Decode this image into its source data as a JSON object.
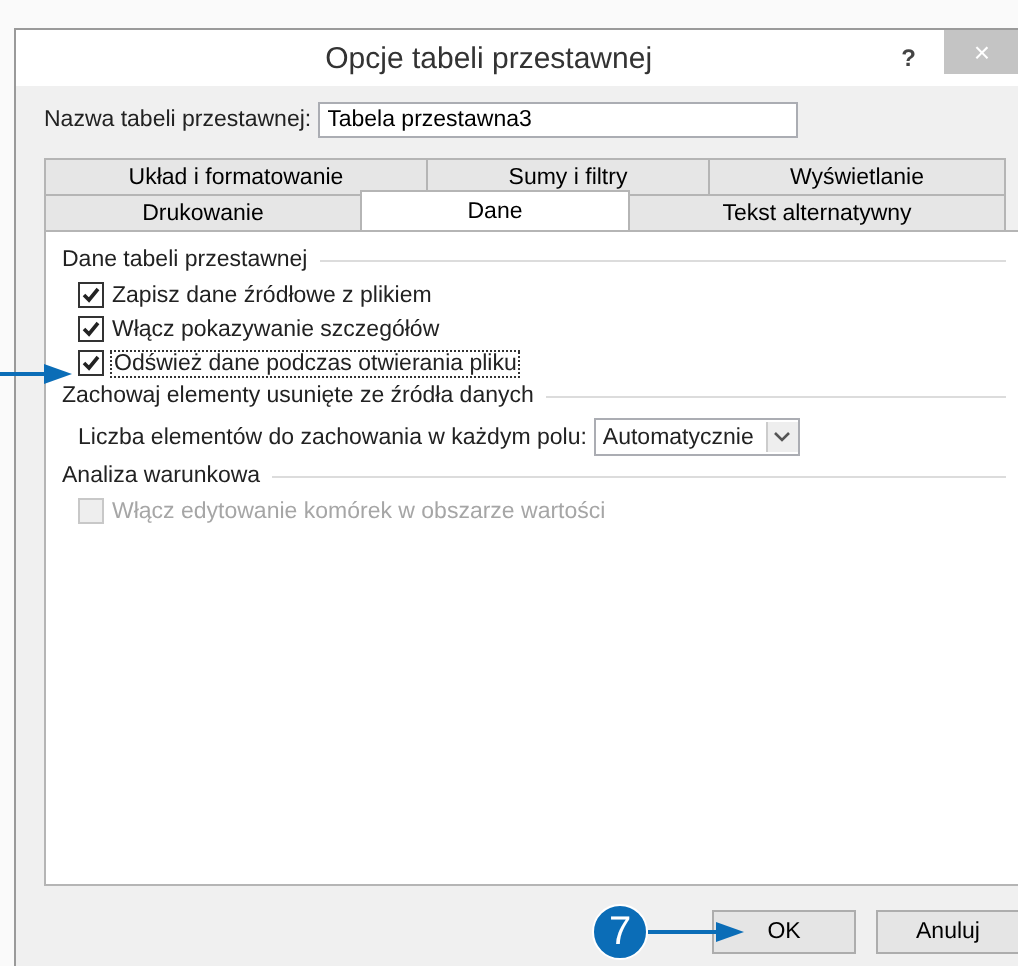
{
  "window": {
    "title": "Opcje tabeli przestawnej",
    "help": "?",
    "close": "×"
  },
  "name_field": {
    "label": "Nazwa tabeli przestawnej:",
    "value": "Tabela przestawna3"
  },
  "tab_rows": [
    [
      {
        "label": "Układ i formatowanie",
        "selected": false
      },
      {
        "label": "Sumy i filtry",
        "selected": false
      },
      {
        "label": "Wyświetlanie",
        "selected": false
      }
    ],
    [
      {
        "label": "Drukowanie",
        "selected": false
      },
      {
        "label": "Dane",
        "selected": true
      },
      {
        "label": "Tekst alternatywny",
        "selected": false
      }
    ]
  ],
  "sections": [
    {
      "title": "Dane tabeli przestawnej",
      "items": [
        {
          "kind": "checkbox",
          "label": "Zapisz dane źródłowe z plikiem",
          "checked": true,
          "disabled": false,
          "focused": false
        },
        {
          "kind": "checkbox",
          "label": "Włącz pokazywanie szczegółów",
          "checked": true,
          "disabled": false,
          "focused": false
        },
        {
          "kind": "checkbox",
          "label": "Odśwież dane podczas otwierania pliku",
          "checked": true,
          "disabled": false,
          "focused": true
        }
      ]
    },
    {
      "title": "Zachowaj elementy usunięte ze źródła danych",
      "items": [
        {
          "kind": "dropdown",
          "label": "Liczba elementów do zachowania w każdym polu:",
          "value": "Automatycznie"
        }
      ]
    },
    {
      "title": "Analiza warunkowa",
      "items": [
        {
          "kind": "checkbox",
          "label": "Włącz edytowanie komórek w obszarze wartości",
          "checked": false,
          "disabled": true,
          "focused": false
        }
      ]
    }
  ],
  "callout": {
    "label": "7"
  },
  "buttons": [
    {
      "label": "OK"
    },
    {
      "label": "Anuluj"
    }
  ]
}
